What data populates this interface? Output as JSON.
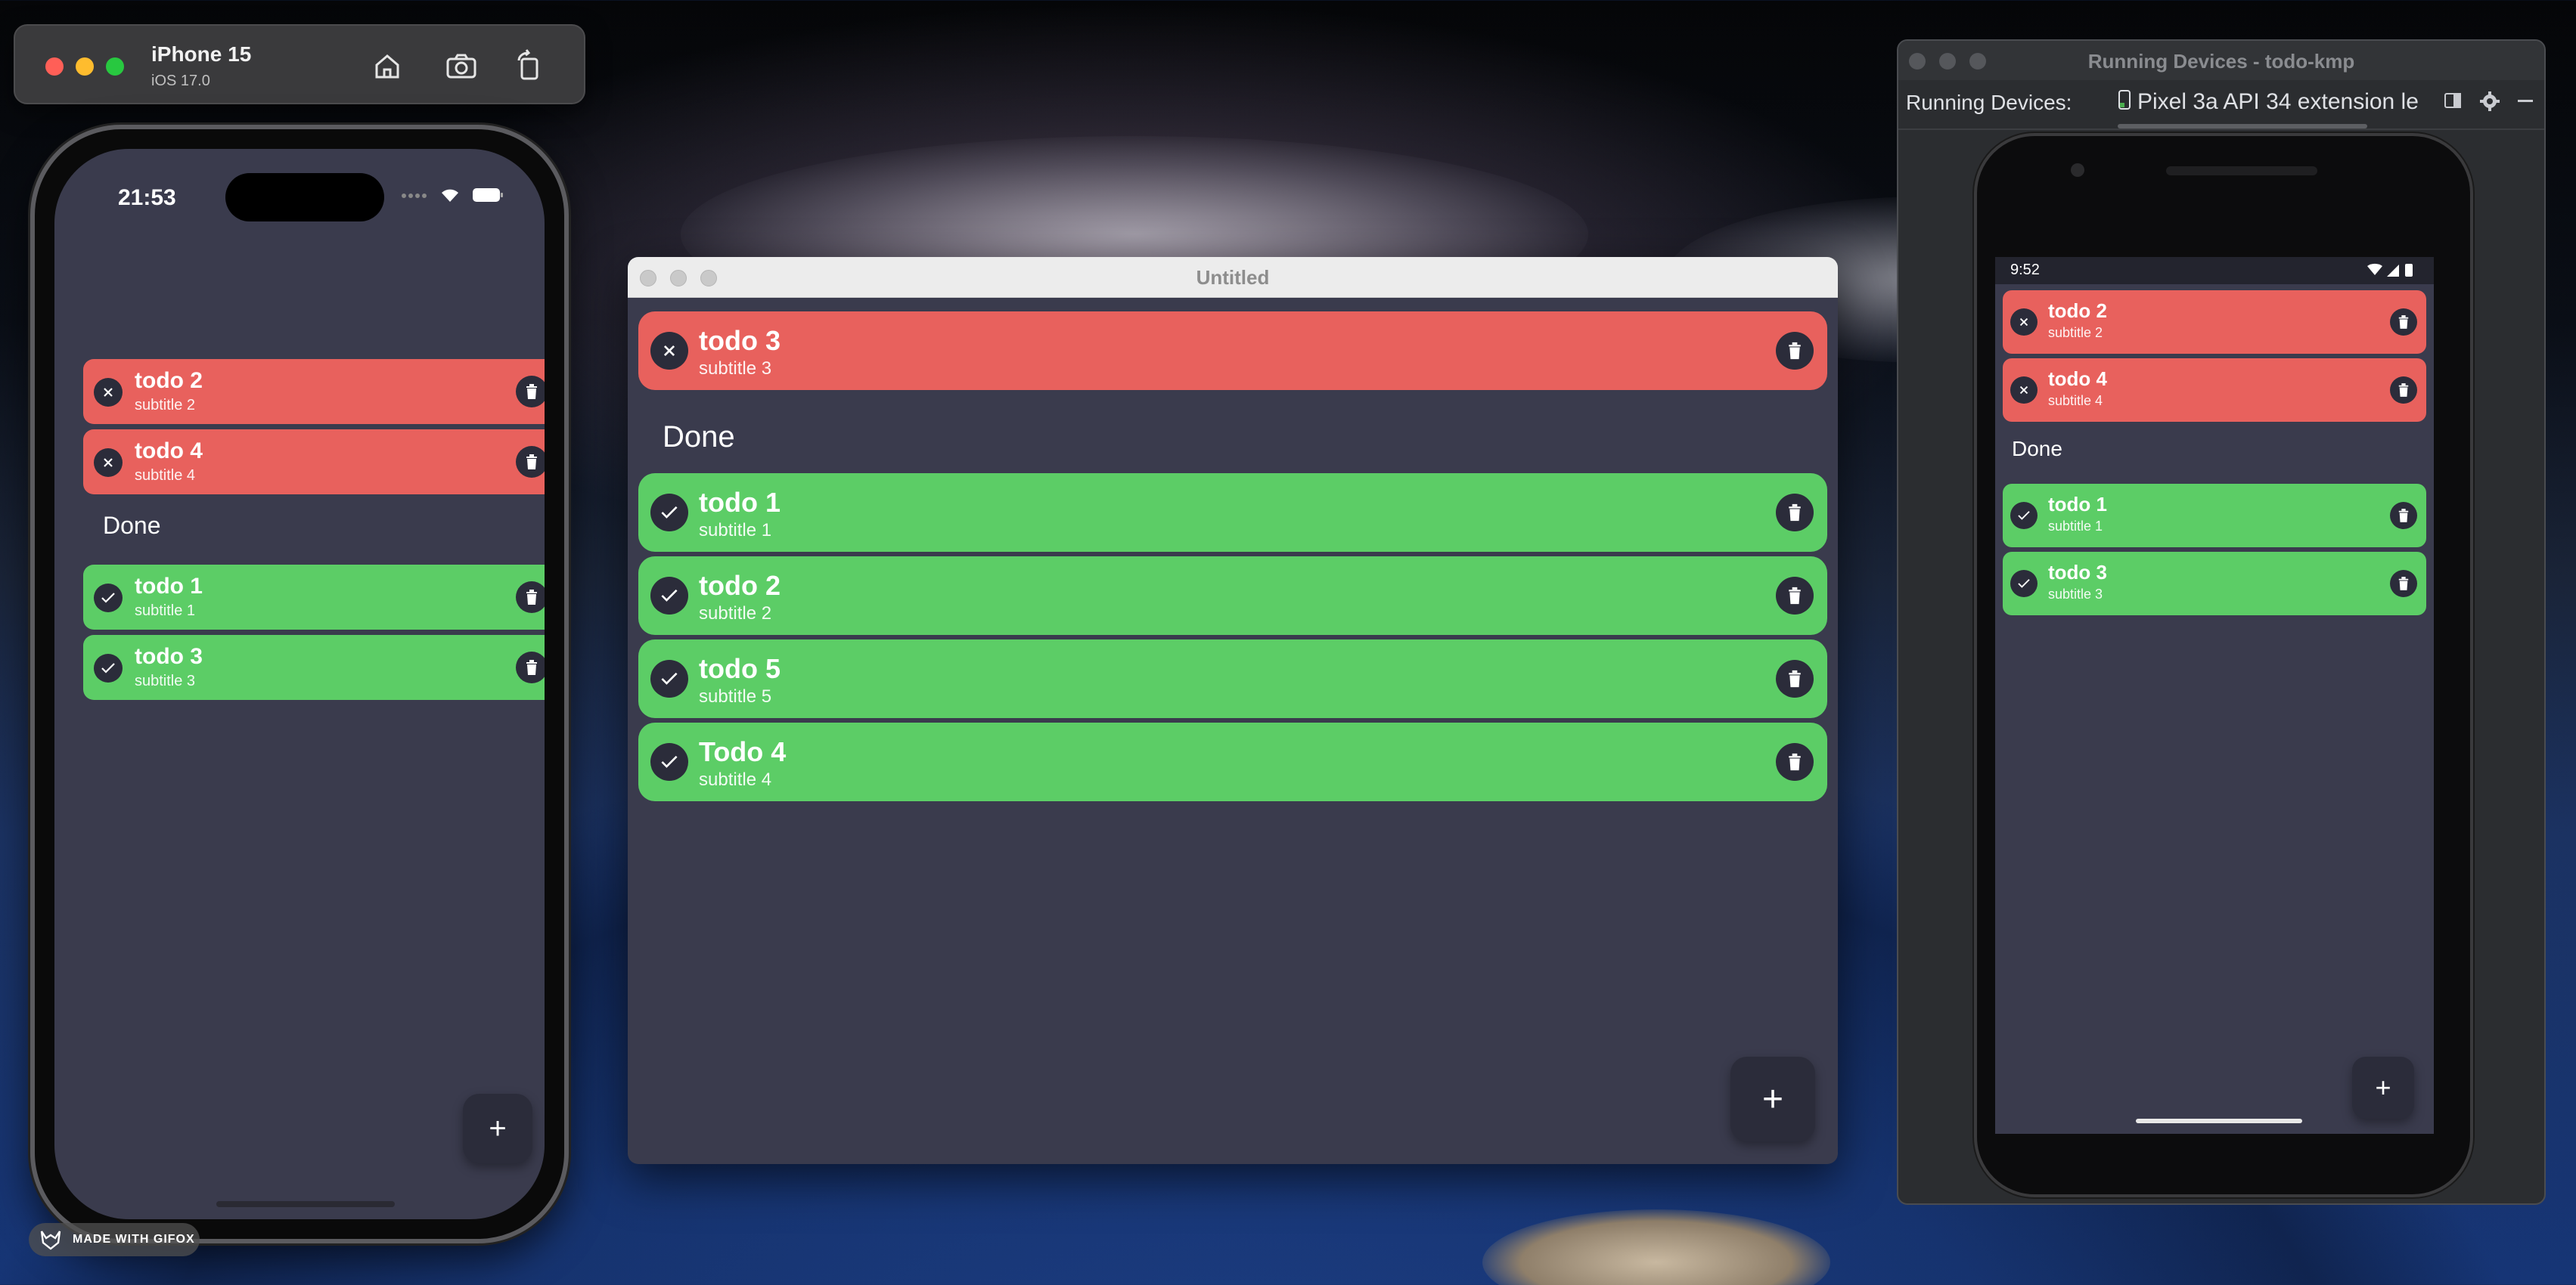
{
  "ios_simulator": {
    "device_name": "iPhone 15",
    "os_version": "iOS 17.0",
    "time": "21:53",
    "todos": [
      {
        "title": "todo 2",
        "subtitle": "subtitle 2",
        "done": false
      },
      {
        "title": "todo 4",
        "subtitle": "subtitle 4",
        "done": false
      }
    ],
    "section_done": "Done",
    "done_todos": [
      {
        "title": "todo 1",
        "subtitle": "subtitle 1",
        "done": true
      },
      {
        "title": "todo 3",
        "subtitle": "subtitle 3",
        "done": true
      }
    ],
    "fab_label": "+"
  },
  "desktop_window": {
    "title": "Untitled",
    "todos": [
      {
        "title": "todo 3",
        "subtitle": "subtitle 3",
        "done": false
      }
    ],
    "section_done": "Done",
    "done_todos": [
      {
        "title": "todo 1",
        "subtitle": "subtitle 1",
        "done": true
      },
      {
        "title": "todo 2",
        "subtitle": "subtitle 2",
        "done": true
      },
      {
        "title": "todo 5",
        "subtitle": "subtitle 5",
        "done": true
      },
      {
        "title": "Todo 4",
        "subtitle": "subtitle 4",
        "done": true
      }
    ],
    "fab_label": "+"
  },
  "android_studio": {
    "window_title": "Running Devices - todo-kmp",
    "panel_label": "Running Devices:",
    "device_tab": "Pixel 3a API 34 extension le",
    "time": "9:52",
    "todos": [
      {
        "title": "todo 2",
        "subtitle": "subtitle 2",
        "done": false
      },
      {
        "title": "todo 4",
        "subtitle": "subtitle 4",
        "done": false
      }
    ],
    "section_done": "Done",
    "done_todos": [
      {
        "title": "todo 1",
        "subtitle": "subtitle 1",
        "done": true
      },
      {
        "title": "todo 3",
        "subtitle": "subtitle 3",
        "done": true
      }
    ],
    "fab_label": "+"
  },
  "watermark": {
    "text": "MADE WITH GIFOX"
  },
  "colors": {
    "todo_pending": "#e8615d",
    "todo_done": "#5ccd66",
    "app_background": "#3a3b4d",
    "icon_background": "#2b2c3a"
  }
}
